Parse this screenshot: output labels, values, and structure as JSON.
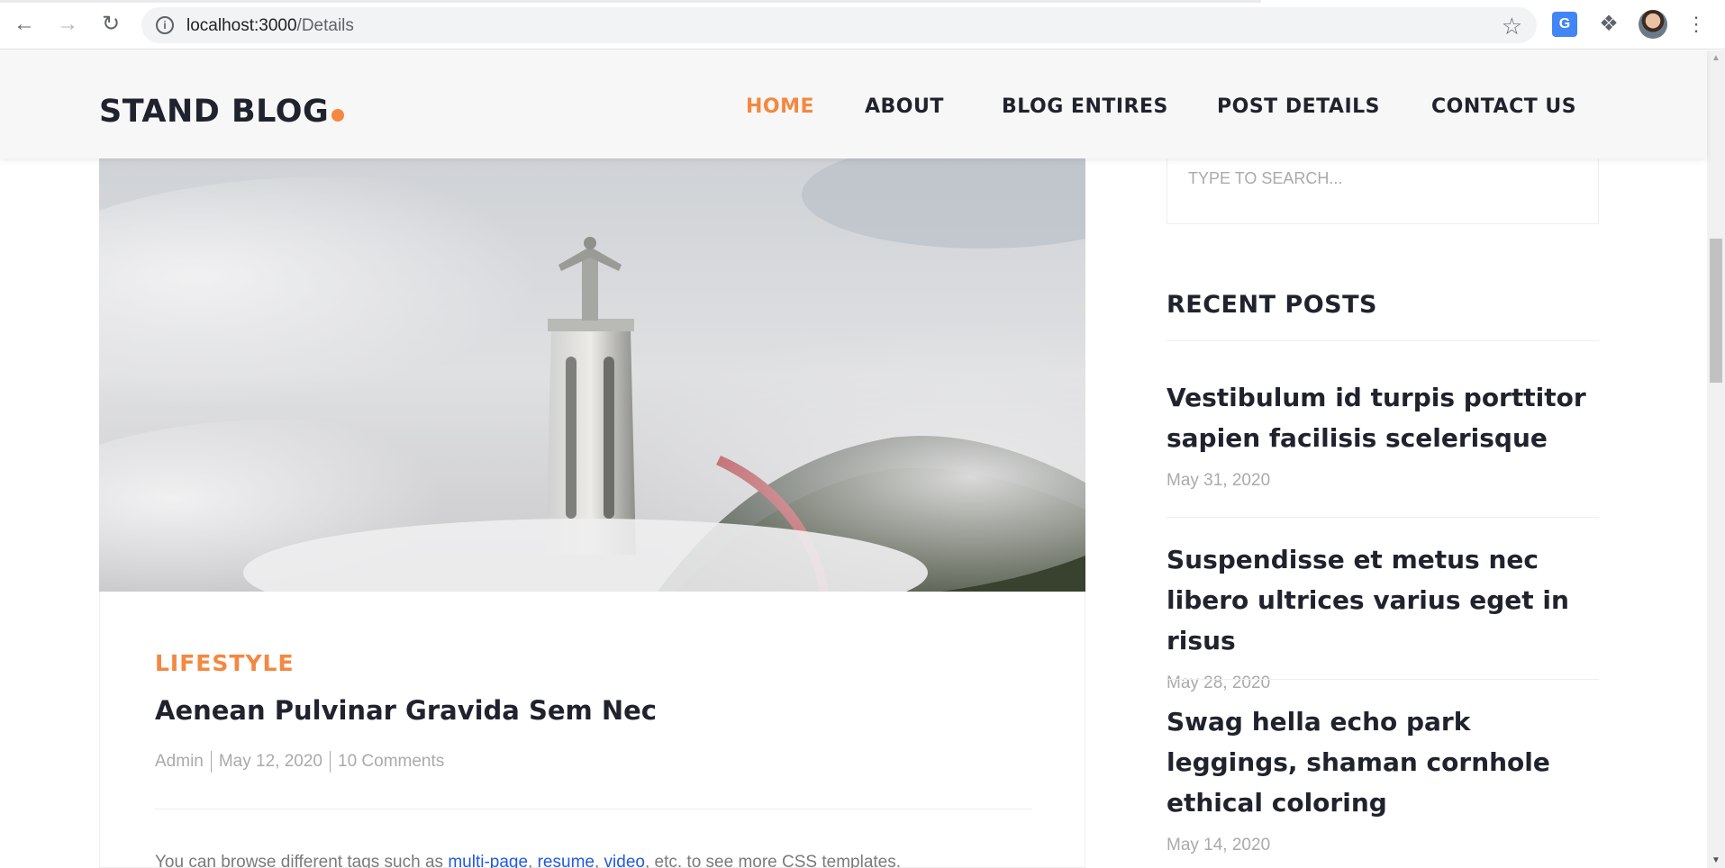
{
  "browser": {
    "url_host": "localhost:3000",
    "url_path": "/Details",
    "icons": [
      "back-icon",
      "forward-icon",
      "reload-icon",
      "info-icon",
      "star-icon",
      "translate-icon",
      "puzzle-icon",
      "avatar",
      "more-icon"
    ]
  },
  "header": {
    "logo": "STAND BLOG",
    "nav": [
      {
        "label": "HOME",
        "active": true
      },
      {
        "label": "ABOUT",
        "active": false
      },
      {
        "label": "BLOG ENTIRES",
        "active": false
      },
      {
        "label": "POST DETAILS",
        "active": false
      },
      {
        "label": "CONTACT US",
        "active": false
      }
    ],
    "accent": "#f48840"
  },
  "post": {
    "category": "LIFESTYLE",
    "title": "Aenean Pulvinar Gravida Sem Nec",
    "author": "Admin",
    "date": "May 12, 2020",
    "comments": "10 Comments",
    "body_prefix": "You can browse different tags such as ",
    "link1": "multi-page",
    "comma1": ", ",
    "link2": "resume",
    "comma2": ", ",
    "link3": "video",
    "body_suffix": ", etc. to see more CSS templates."
  },
  "sidebar": {
    "search_placeholder": "TYPE TO SEARCH...",
    "recent_heading": "RECENT POSTS",
    "recent_posts": [
      {
        "title": "Vestibulum id turpis porttitor sapien facilisis scelerisque",
        "date": "May 31, 2020"
      },
      {
        "title": "Suspendisse et metus nec libero ultrices varius eget in risus",
        "date": "May 28, 2020"
      },
      {
        "title": "Swag hella echo park leggings, shaman cornhole ethical coloring",
        "date": "May 14, 2020"
      }
    ]
  }
}
